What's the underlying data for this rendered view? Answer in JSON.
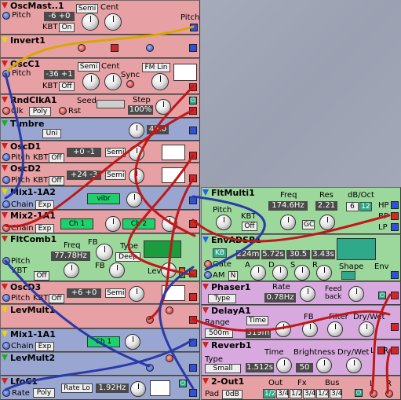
{
  "colors": {
    "red_mod": "#e7a0a4",
    "blue_mod": "#9aa6d2",
    "green_mod": "#9cd79c",
    "yellow_mod": "#e8e194",
    "pink_mod": "#d8a9de",
    "cable_red": "#c01818",
    "cable_blue": "#2a3aa8",
    "cable_yellow": "#d8a800"
  },
  "modules": {
    "osc_master": {
      "title": "OscMast..1",
      "pitch": "Pitch",
      "display": "-6  +0",
      "semi": "Semi",
      "cent": "Cent",
      "kbt": "KBT",
      "on": "On",
      "out_label": "Pitch"
    },
    "invert": {
      "title": "Invert1"
    },
    "osc_c": {
      "title": "OscC1",
      "pitch": "Pitch",
      "display": "-36  +1",
      "semi": "Semi",
      "cent": "Cent",
      "kbt": "KBT",
      "off": "Off",
      "sync": "Sync",
      "fm_lin": "FM Lin"
    },
    "rnd_clk": {
      "title": "RndClkA1",
      "clk": "Clk",
      "poly": "Poly",
      "rst": "Rst",
      "seed": "Seed",
      "step": "Step",
      "step_value": "100%"
    },
    "timbre": {
      "title": "Timbre",
      "uni": "Uni",
      "display": "48.0"
    },
    "osc_d1": {
      "title": "OscD1",
      "pitch": "Pitch",
      "kbt": "KBT",
      "off": "Off",
      "display": "+0  -1",
      "semi": "Semi"
    },
    "osc_d2": {
      "title": "OscD2",
      "pitch": "Pitch",
      "kbt": "KBT",
      "off": "Off",
      "display": "+24  -3",
      "semi": "Semi"
    },
    "mix_1a2": {
      "title": "Mix1-1A2",
      "chain": "Chain",
      "exp": "Exp",
      "vibr": "vibr"
    },
    "mix_21a1": {
      "title": "Mix2-1A1",
      "chain": "Chain",
      "exp": "Exp",
      "ch1": "Ch 1",
      "ch2": "Ch 2"
    },
    "flt_comb": {
      "title": "FltComb1",
      "freq": "Freq",
      "fb": "FB",
      "type": "Type",
      "freq_value": "77.78Hz",
      "deep": "Deep",
      "pitch": "Pitch",
      "kbt": "KBT",
      "off": "Off",
      "fb2": "FB",
      "lev": "Lev"
    },
    "osc_d3": {
      "title": "OscD3",
      "pitch": "Pitch",
      "kbt": "KBT",
      "off": "Off",
      "display": "+6  +0",
      "semi": "Semi"
    },
    "lev_mult1": {
      "title": "LevMult1"
    },
    "mix_11a1": {
      "title": "Mix1-1A1",
      "chain": "Chain",
      "exp": "Exp",
      "ch1": "Ch 1"
    },
    "lev_mult2": {
      "title": "LevMult2"
    },
    "lfo_c": {
      "title": "LfoC1",
      "rate": "Rate",
      "poly": "Poly",
      "rate_lo": "Rate Lo",
      "display": "1.92Hz"
    },
    "flt_multi": {
      "title": "FltMulti1",
      "freq": "Freq",
      "res": "Res",
      "db_oct": "dB/Oct",
      "pitch": "Pitch",
      "kbt": "KBT",
      "off": "Off",
      "freq_value": "174.6Hz",
      "res_value": "2.21",
      "gc": "GC",
      "db6": "6",
      "db12": "12",
      "hp": "HP",
      "bp": "BP",
      "lp": "LP"
    },
    "env_adsr": {
      "title": "EnvADSR1",
      "kb": "KB",
      "a_value": "224m",
      "d_value": "5.72s",
      "s_value": "30.5",
      "r_value": "3.43s",
      "gate": "Gate",
      "a": "A",
      "d": "D",
      "s": "S",
      "r": "R",
      "am": "AM",
      "n": "N",
      "shape": "Shape",
      "env": "Env"
    },
    "phaser": {
      "title": "Phaser1",
      "type": "Type",
      "rate": "Rate",
      "rate_value": "0.78Hz",
      "feedback": "Feed back"
    },
    "delay": {
      "title": "DelayA1",
      "range": "Range",
      "time": "Time",
      "fb": "FB",
      "filter": "Filter",
      "dry_wet": "Dry/Wet",
      "range_value": "500m",
      "time_value": "319m"
    },
    "reverb": {
      "title": "Reverb1",
      "type": "Type",
      "time": "Time",
      "brightness": "Brightness",
      "dry_wet": "Dry/Wet",
      "type_value": "Small",
      "time_value": "1.512s",
      "brightness_value": "50",
      "l": "L",
      "r": "R"
    },
    "out2": {
      "title": "2-Out1",
      "pad": "Pad",
      "pad_value": "0dB",
      "out": "Out",
      "fx": "Fx",
      "bus": "Bus",
      "out_12": "1/2",
      "out_34": "3/4",
      "fx_12": "1/2",
      "fx_34": "3/4",
      "bus_12": "1/2",
      "bus_34": "3/4",
      "l": "L",
      "r": "R"
    }
  }
}
